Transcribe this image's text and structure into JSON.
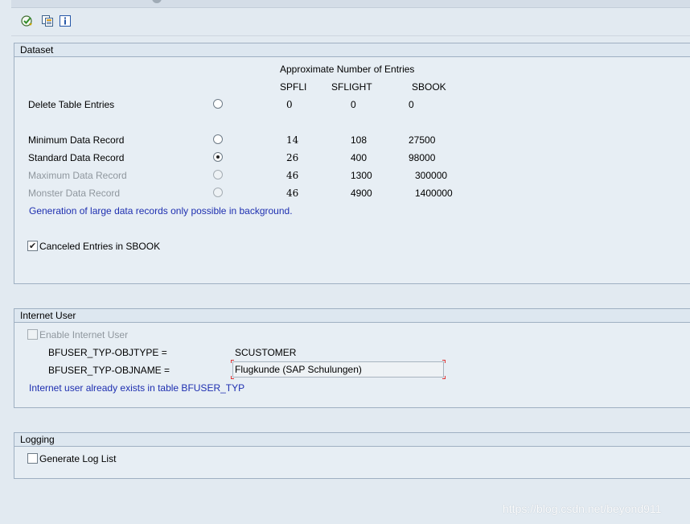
{
  "toolbar": {
    "icons": [
      "execute-icon",
      "copy-variant-icon",
      "info-icon"
    ]
  },
  "dataset": {
    "title": "Dataset",
    "approx_header": "Approximate Number of Entries",
    "columns": [
      "SPFLI",
      "SFLIGHT",
      "SBOOK"
    ],
    "rows": [
      {
        "label": "Delete Table Entries",
        "spfli": "0",
        "sflight": "0",
        "sbook": "0",
        "selected": false,
        "enabled": true
      },
      {
        "label": "Minimum Data Record",
        "spfli": "14",
        "sflight": "108",
        "sbook": "27500",
        "selected": false,
        "enabled": true
      },
      {
        "label": "Standard Data Record",
        "spfli": "26",
        "sflight": "400",
        "sbook": "98000",
        "selected": true,
        "enabled": true
      },
      {
        "label": "Maximum Data Record",
        "spfli": "46",
        "sflight": "1300",
        "sbook": "300000",
        "selected": false,
        "enabled": false
      },
      {
        "label": "Monster Data Record",
        "spfli": "46",
        "sflight": "4900",
        "sbook": "1400000",
        "selected": false,
        "enabled": false
      }
    ],
    "note": "Generation of large data records only possible in background.",
    "canceled_label": "Canceled Entries in SBOOK",
    "canceled_checked": true
  },
  "internet_user": {
    "title": "Internet User",
    "enable_label": "Enable Internet User",
    "enable_checked": false,
    "objtype_label": "BFUSER_TYP-OBJTYPE =",
    "objtype_value": "SCUSTOMER",
    "objname_label": "BFUSER_TYP-OBJNAME =",
    "objname_value": "Flugkunde (SAP Schulungen)",
    "note": "Internet user already exists in table BFUSER_TYP"
  },
  "logging": {
    "title": "Logging",
    "generate_label": "Generate Log List",
    "generate_checked": false
  },
  "watermark": "https://blog.csdn.net/beyond911",
  "colors": {
    "background": "#e2eaf1",
    "info_text": "#1e2fb0",
    "disabled_text": "#8f979e",
    "required_marker": "#dd3333"
  }
}
